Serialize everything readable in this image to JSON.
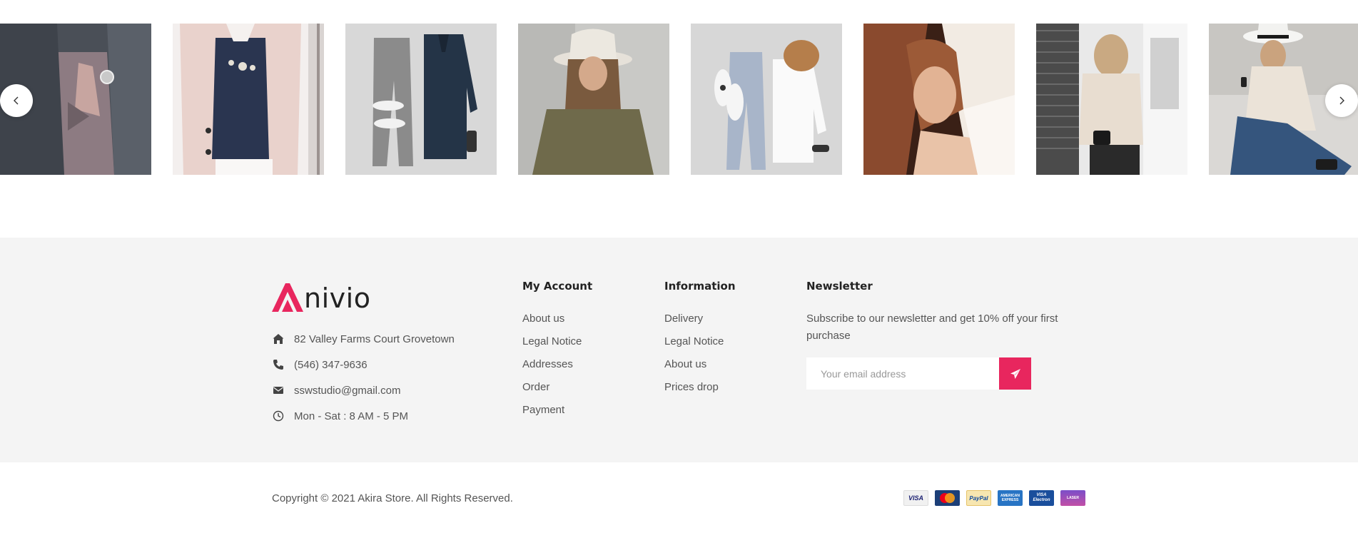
{
  "gallery": {
    "prev_icon": "chevron-left-icon",
    "next_icon": "chevron-right-icon",
    "photos": [
      {
        "subject": "gray-blazer-model"
      },
      {
        "subject": "pink-coat-model"
      },
      {
        "subject": "pants-shirt-flatlay"
      },
      {
        "subject": "hat-woman-olive-shirt"
      },
      {
        "subject": "jeans-shirt-cap-flatlay"
      },
      {
        "subject": "woman-fur-portrait"
      },
      {
        "subject": "woman-beige-sweater-street"
      },
      {
        "subject": "woman-hat-phone-sitting"
      }
    ]
  },
  "footer": {
    "brand": {
      "logo_letter": "A",
      "name": "nivio",
      "accent_color": "#e8265e"
    },
    "contact": [
      {
        "icon": "home-icon",
        "text": "82 Valley Farms Court Grovetown"
      },
      {
        "icon": "phone-icon",
        "text": "(546) 347-9636"
      },
      {
        "icon": "envelope-icon",
        "text": "sswstudio@gmail.com"
      },
      {
        "icon": "clock-icon",
        "text": "Mon - Sat : 8 AM - 5 PM"
      }
    ],
    "my_account": {
      "title": "My Account",
      "links": [
        "About us",
        "Legal Notice",
        "Addresses",
        "Order",
        "Payment"
      ]
    },
    "information": {
      "title": "Information",
      "links": [
        "Delivery",
        "Legal Notice",
        "About us",
        "Prices drop"
      ]
    },
    "newsletter": {
      "title": "Newsletter",
      "text": "Subscribe to our newsletter and get 10% off your first purchase",
      "placeholder": "Your email address",
      "submit_icon": "paper-plane-icon",
      "button_color": "#e8265e"
    }
  },
  "bottom": {
    "copyright": "Copyright © 2021 Akira Store. All Rights Reserved.",
    "payments": [
      {
        "name": "visa-icon",
        "label": "VISA"
      },
      {
        "name": "mastercard-icon",
        "label": "MasterCard"
      },
      {
        "name": "paypal-icon",
        "label": "PayPal"
      },
      {
        "name": "american-express-icon",
        "label": "AMERICAN EXPRESS"
      },
      {
        "name": "visa-electron-icon",
        "label": "VISA Electron"
      },
      {
        "name": "laser-icon",
        "label": "LASER"
      }
    ]
  }
}
